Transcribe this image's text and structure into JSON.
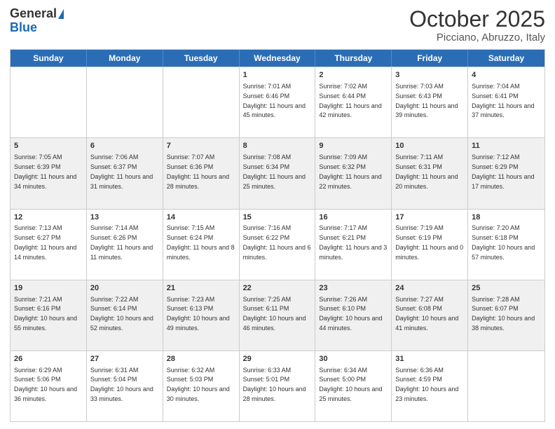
{
  "header": {
    "logo_general": "General",
    "logo_blue": "Blue",
    "title": "October 2025",
    "location": "Picciano, Abruzzo, Italy"
  },
  "weekdays": [
    "Sunday",
    "Monday",
    "Tuesday",
    "Wednesday",
    "Thursday",
    "Friday",
    "Saturday"
  ],
  "rows": [
    [
      {
        "day": "",
        "text": ""
      },
      {
        "day": "",
        "text": ""
      },
      {
        "day": "",
        "text": ""
      },
      {
        "day": "1",
        "text": "Sunrise: 7:01 AM\nSunset: 6:46 PM\nDaylight: 11 hours and 45 minutes."
      },
      {
        "day": "2",
        "text": "Sunrise: 7:02 AM\nSunset: 6:44 PM\nDaylight: 11 hours and 42 minutes."
      },
      {
        "day": "3",
        "text": "Sunrise: 7:03 AM\nSunset: 6:43 PM\nDaylight: 11 hours and 39 minutes."
      },
      {
        "day": "4",
        "text": "Sunrise: 7:04 AM\nSunset: 6:41 PM\nDaylight: 11 hours and 37 minutes."
      }
    ],
    [
      {
        "day": "5",
        "text": "Sunrise: 7:05 AM\nSunset: 6:39 PM\nDaylight: 11 hours and 34 minutes."
      },
      {
        "day": "6",
        "text": "Sunrise: 7:06 AM\nSunset: 6:37 PM\nDaylight: 11 hours and 31 minutes."
      },
      {
        "day": "7",
        "text": "Sunrise: 7:07 AM\nSunset: 6:36 PM\nDaylight: 11 hours and 28 minutes."
      },
      {
        "day": "8",
        "text": "Sunrise: 7:08 AM\nSunset: 6:34 PM\nDaylight: 11 hours and 25 minutes."
      },
      {
        "day": "9",
        "text": "Sunrise: 7:09 AM\nSunset: 6:32 PM\nDaylight: 11 hours and 22 minutes."
      },
      {
        "day": "10",
        "text": "Sunrise: 7:11 AM\nSunset: 6:31 PM\nDaylight: 11 hours and 20 minutes."
      },
      {
        "day": "11",
        "text": "Sunrise: 7:12 AM\nSunset: 6:29 PM\nDaylight: 11 hours and 17 minutes."
      }
    ],
    [
      {
        "day": "12",
        "text": "Sunrise: 7:13 AM\nSunset: 6:27 PM\nDaylight: 11 hours and 14 minutes."
      },
      {
        "day": "13",
        "text": "Sunrise: 7:14 AM\nSunset: 6:26 PM\nDaylight: 11 hours and 11 minutes."
      },
      {
        "day": "14",
        "text": "Sunrise: 7:15 AM\nSunset: 6:24 PM\nDaylight: 11 hours and 8 minutes."
      },
      {
        "day": "15",
        "text": "Sunrise: 7:16 AM\nSunset: 6:22 PM\nDaylight: 11 hours and 6 minutes."
      },
      {
        "day": "16",
        "text": "Sunrise: 7:17 AM\nSunset: 6:21 PM\nDaylight: 11 hours and 3 minutes."
      },
      {
        "day": "17",
        "text": "Sunrise: 7:19 AM\nSunset: 6:19 PM\nDaylight: 11 hours and 0 minutes."
      },
      {
        "day": "18",
        "text": "Sunrise: 7:20 AM\nSunset: 6:18 PM\nDaylight: 10 hours and 57 minutes."
      }
    ],
    [
      {
        "day": "19",
        "text": "Sunrise: 7:21 AM\nSunset: 6:16 PM\nDaylight: 10 hours and 55 minutes."
      },
      {
        "day": "20",
        "text": "Sunrise: 7:22 AM\nSunset: 6:14 PM\nDaylight: 10 hours and 52 minutes."
      },
      {
        "day": "21",
        "text": "Sunrise: 7:23 AM\nSunset: 6:13 PM\nDaylight: 10 hours and 49 minutes."
      },
      {
        "day": "22",
        "text": "Sunrise: 7:25 AM\nSunset: 6:11 PM\nDaylight: 10 hours and 46 minutes."
      },
      {
        "day": "23",
        "text": "Sunrise: 7:26 AM\nSunset: 6:10 PM\nDaylight: 10 hours and 44 minutes."
      },
      {
        "day": "24",
        "text": "Sunrise: 7:27 AM\nSunset: 6:08 PM\nDaylight: 10 hours and 41 minutes."
      },
      {
        "day": "25",
        "text": "Sunrise: 7:28 AM\nSunset: 6:07 PM\nDaylight: 10 hours and 38 minutes."
      }
    ],
    [
      {
        "day": "26",
        "text": "Sunrise: 6:29 AM\nSunset: 5:06 PM\nDaylight: 10 hours and 36 minutes."
      },
      {
        "day": "27",
        "text": "Sunrise: 6:31 AM\nSunset: 5:04 PM\nDaylight: 10 hours and 33 minutes."
      },
      {
        "day": "28",
        "text": "Sunrise: 6:32 AM\nSunset: 5:03 PM\nDaylight: 10 hours and 30 minutes."
      },
      {
        "day": "29",
        "text": "Sunrise: 6:33 AM\nSunset: 5:01 PM\nDaylight: 10 hours and 28 minutes."
      },
      {
        "day": "30",
        "text": "Sunrise: 6:34 AM\nSunset: 5:00 PM\nDaylight: 10 hours and 25 minutes."
      },
      {
        "day": "31",
        "text": "Sunrise: 6:36 AM\nSunset: 4:59 PM\nDaylight: 10 hours and 23 minutes."
      },
      {
        "day": "",
        "text": ""
      }
    ]
  ]
}
